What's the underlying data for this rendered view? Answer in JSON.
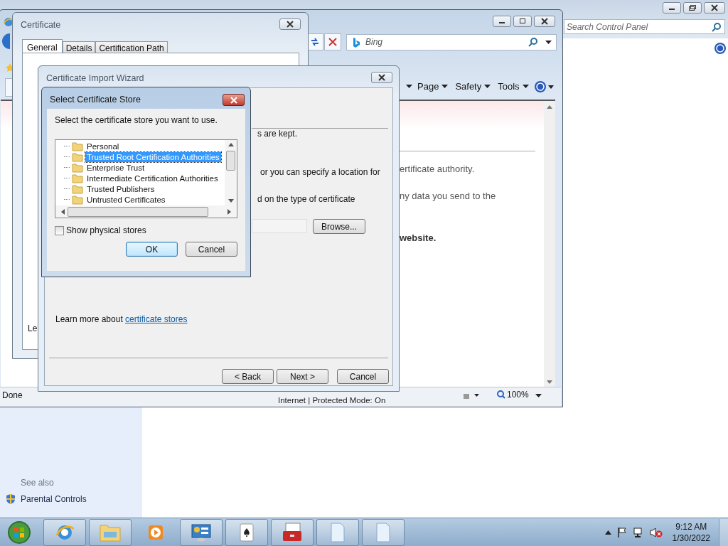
{
  "control_panel": {
    "search": {
      "placeholder": "Search Control Panel"
    },
    "see_also": "See also",
    "links": [
      {
        "label": "Parental Controls"
      }
    ]
  },
  "browser": {
    "search": {
      "placeholder": "Bing"
    },
    "command_bar": [
      {
        "label": "Page"
      },
      {
        "label": "Safety"
      },
      {
        "label": "Tools"
      }
    ],
    "content_lines": [
      {
        "text": "ertificate authority.",
        "bold": false
      },
      {
        "text": "ny data you send to the",
        "bold": false
      },
      {
        "text": "website.",
        "bold": true
      }
    ],
    "status_bar": {
      "text": "Done",
      "zone": "Internet | Protected Mode: On",
      "zoom": "100%"
    }
  },
  "certificate_window": {
    "title": "Certificate",
    "tabs": [
      {
        "label": "General",
        "selected": true
      },
      {
        "label": "Details",
        "selected": false
      },
      {
        "label": "Certification Path",
        "selected": false
      }
    ],
    "content_fragment": "Le"
  },
  "import_wizard": {
    "title": "Certificate Import Wizard",
    "fragments": [
      "s are kept.",
      "or you can specify a location for",
      "d on the type of certificate"
    ],
    "browse_button": "Browse...",
    "learn_more": {
      "text": "Learn more about",
      "link": "certificate stores"
    },
    "buttons": [
      "< Back",
      "Next >",
      "Cancel"
    ]
  },
  "store_dialog": {
    "title": "Select Certificate Store",
    "instruction": "Select the certificate store you want to use.",
    "stores": [
      {
        "label": "Personal",
        "selected": false
      },
      {
        "label": "Trusted Root Certification Authorities",
        "selected": true
      },
      {
        "label": "Enterprise Trust",
        "selected": false
      },
      {
        "label": "Intermediate Certification Authorities",
        "selected": false
      },
      {
        "label": "Trusted Publishers",
        "selected": false
      },
      {
        "label": "Untrusted Certificates",
        "selected": false
      }
    ],
    "show_physical_stores": {
      "label": "Show physical stores",
      "checked": false
    },
    "buttons": [
      {
        "label": "OK",
        "default": true
      },
      {
        "label": "Cancel",
        "default": false
      }
    ]
  },
  "taskbar": {
    "time": "9:12 AM",
    "date": "1/30/2022"
  }
}
